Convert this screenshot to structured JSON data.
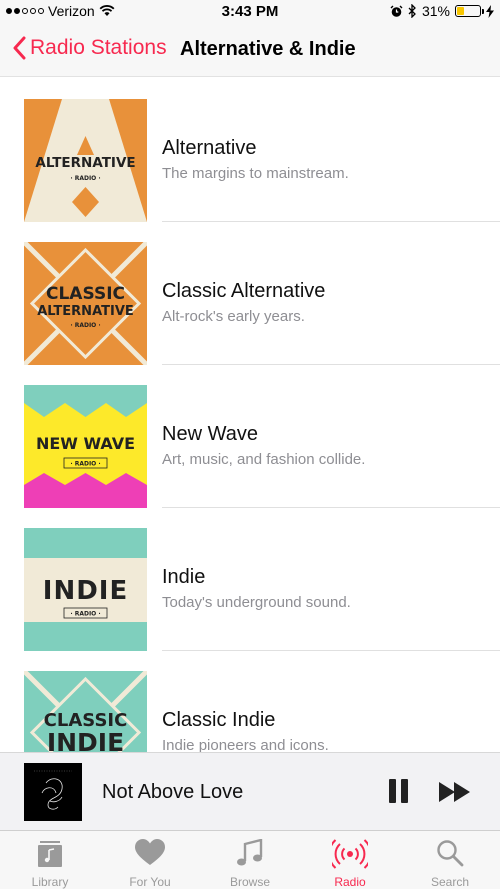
{
  "status_bar": {
    "carrier": "Verizon",
    "time": "3:43 PM",
    "battery": "31%",
    "battery_level": 0.31,
    "signal_bars": 2,
    "signal_total": 5
  },
  "nav": {
    "back_label": "Radio Stations",
    "title": "Alternative & Indie"
  },
  "stations": [
    {
      "name": "Alternative",
      "description": "The margins to mainstream.",
      "art_title": "ALTERNATIVE",
      "art_sub": "· RADIO ·"
    },
    {
      "name": "Classic Alternative",
      "description": "Alt-rock's early years.",
      "art_title1": "CLASSIC",
      "art_title2": "ALTERNATIVE",
      "art_sub": "· RADIO ·"
    },
    {
      "name": "New Wave",
      "description": "Art, music, and fashion collide.",
      "art_title": "NEW WAVE",
      "art_sub": "· RADIO ·"
    },
    {
      "name": "Indie",
      "description": "Today's underground sound.",
      "art_title": "INDIE",
      "art_sub": "· RADIO ·"
    },
    {
      "name": "Classic Indie",
      "description": "Indie pioneers and icons.",
      "art_title1": "CLASSIC",
      "art_title2": "INDIE"
    }
  ],
  "mini_player": {
    "track_title": "Not Above Love"
  },
  "tabs": [
    {
      "label": "Library",
      "icon": "library-icon"
    },
    {
      "label": "For You",
      "icon": "heart-icon"
    },
    {
      "label": "Browse",
      "icon": "music-note-icon"
    },
    {
      "label": "Radio",
      "icon": "radio-icon",
      "active": true
    },
    {
      "label": "Search",
      "icon": "search-icon"
    }
  ],
  "colors": {
    "accent": "#f7294f",
    "orange": "#e8913a",
    "cream": "#f1ead7",
    "mint": "#7fcfbd",
    "yellow": "#fde92a",
    "magenta": "#ee3fb6"
  }
}
